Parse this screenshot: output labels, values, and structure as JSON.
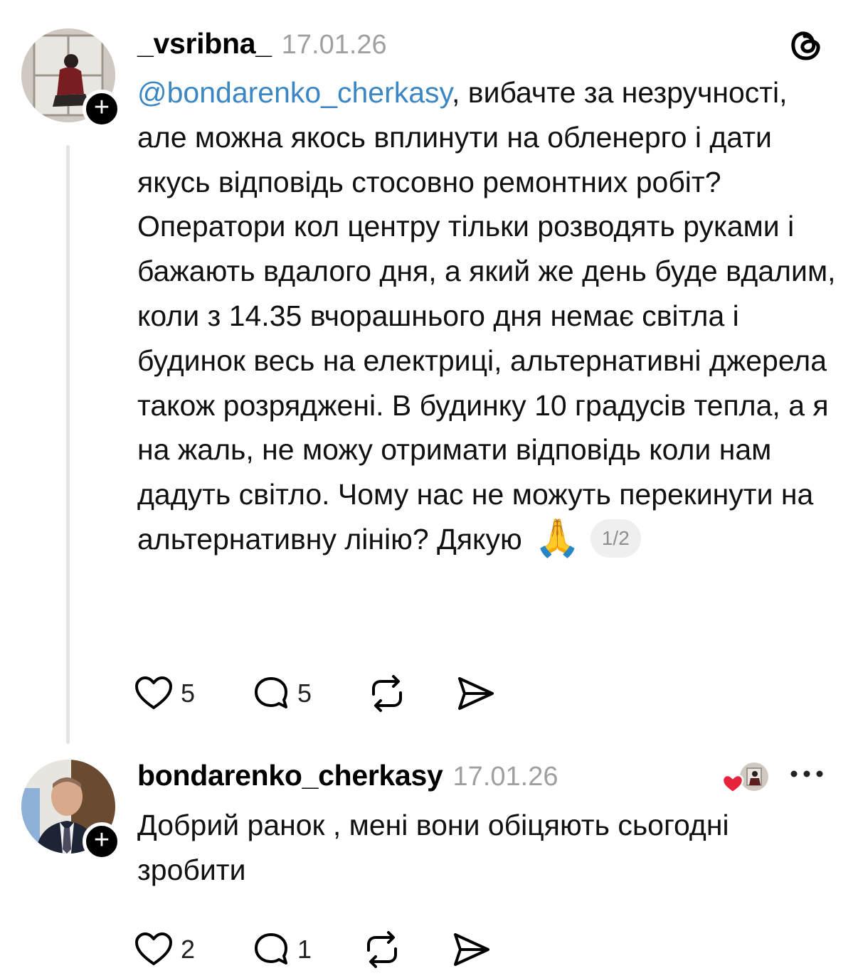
{
  "post1": {
    "username": "_vsribna_",
    "date": "17.01.26",
    "mention": "@bondarenko_cherkasy",
    "text": ", вибачте за незручності, але можна якось вплинути на обленерго і дати якусь відповідь стосовно ремонтних робіт? Оператори кол центру тільки розводять руками і бажають вдалого дня, а який же день буде вдалим, коли з 14.35 вчорашнього дня немає світла і будинок весь на електриці, альтернативні джерела також розряджені. В будинку 10 градусів тепла, а я на жаль, не можу отримати відповідь коли нам дадуть світло. Чому нас не можуть перекинути на альтернативну лінію? Дякую",
    "emoji": "🙏",
    "page_indicator": "1/2",
    "likes": "5",
    "replies": "5"
  },
  "post2": {
    "username": "bondarenko_cherkasy",
    "date": "17.01.26",
    "text": "Добрий ранок , мені вони обіцяють сьогодні зробити",
    "likes": "2",
    "replies": "1"
  },
  "icons": {
    "follow": "plus-icon",
    "app": "threads-logo-icon",
    "like": "heart-icon",
    "reply": "comment-icon",
    "repost": "repost-icon",
    "share": "send-icon",
    "more": "more-dots-icon",
    "liked_by_author": "heart-filled-icon"
  },
  "colors": {
    "mention": "#3b86c4",
    "date": "#a0a0a0",
    "heart_red": "#e8243c",
    "thread_line": "#e3e3e3"
  },
  "badge": "+"
}
